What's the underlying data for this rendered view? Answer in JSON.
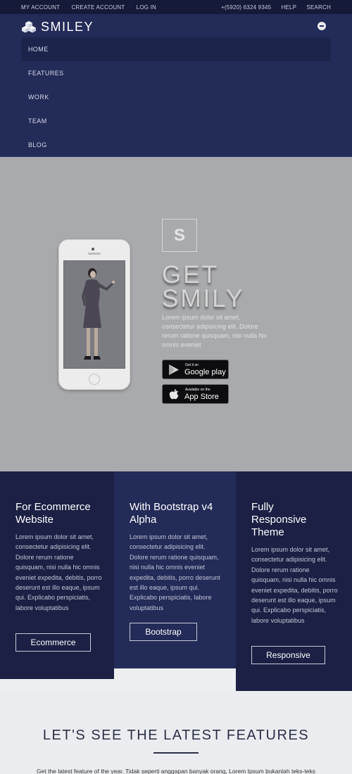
{
  "topbar": {
    "my_account": "MY ACCOUNT",
    "create_account": "CREATE ACCOUNT",
    "log_in": "LOG IN",
    "phone": "+(5920) 6324 9345",
    "help": "HELP",
    "search": "SEARCH"
  },
  "brand": {
    "name": "SMILEY"
  },
  "nav": {
    "items": [
      {
        "label": "HOME"
      },
      {
        "label": "FEATURES"
      },
      {
        "label": "WORK"
      },
      {
        "label": "TEAM"
      },
      {
        "label": "BLOG"
      }
    ]
  },
  "hero": {
    "logo_letter": "S",
    "title_line1": "GET",
    "title_line2": "SMILY",
    "text": "Lorem ipsum dolor sit amet, consectetur adipisicing elit. Dolore rerum ratione quisquam, nisi nulla hic omnis eveniet",
    "google_small": "Get it on",
    "google_large": "Google play",
    "apple_small": "Available on the",
    "apple_large": "App Store"
  },
  "features": [
    {
      "title": "For Ecommerce Website",
      "text": "Lorem ipsum dolor sit amet, consectetur adipisicing elit. Dolore rerum ratione quisquam, nisi nulla hic omnis eveniet expedita, debitis, porro deserunt est illo eaque, ipsum qui. Explicabo perspiciatis, labore voluptatibus",
      "button": "Ecommerce"
    },
    {
      "title": "With Bootstrap v4 Alpha",
      "text": "Lorem ipsum dolor sit amet, consectetur adipisicing elit. Dolore rerum ratione quisquam, nisi nulla hic omnis eveniet expedita, debitis, porro deserunt est illo eaque, ipsum qui. Explicabo perspiciatis, labore voluptatibus",
      "button": "Bootstrap"
    },
    {
      "title": "Fully Responsive Theme",
      "text": "Lorem ipsum dolor sit amet, consectetur adipisicing elit. Dolore rerum ratione quisquam, nisi nulla hic omnis eveniet expedita, debitis, porro deserunt est illo eaque, ipsum qui. Explicabo perspiciatis, labore voluptatibus",
      "button": "Responsive"
    }
  ],
  "latest": {
    "heading": "LET'S SEE THE LATEST FEATURES",
    "text": "Get the latest feature of the year. Tidak seperti anggapan banyak orang, Lorem Ipsum bukanlah teks-teks"
  },
  "colors": {
    "topbar": "#141a38",
    "header": "#232b58",
    "hero": "#a9aaad",
    "feature_dark": "#1b2044",
    "feature_mid": "#232b58"
  }
}
